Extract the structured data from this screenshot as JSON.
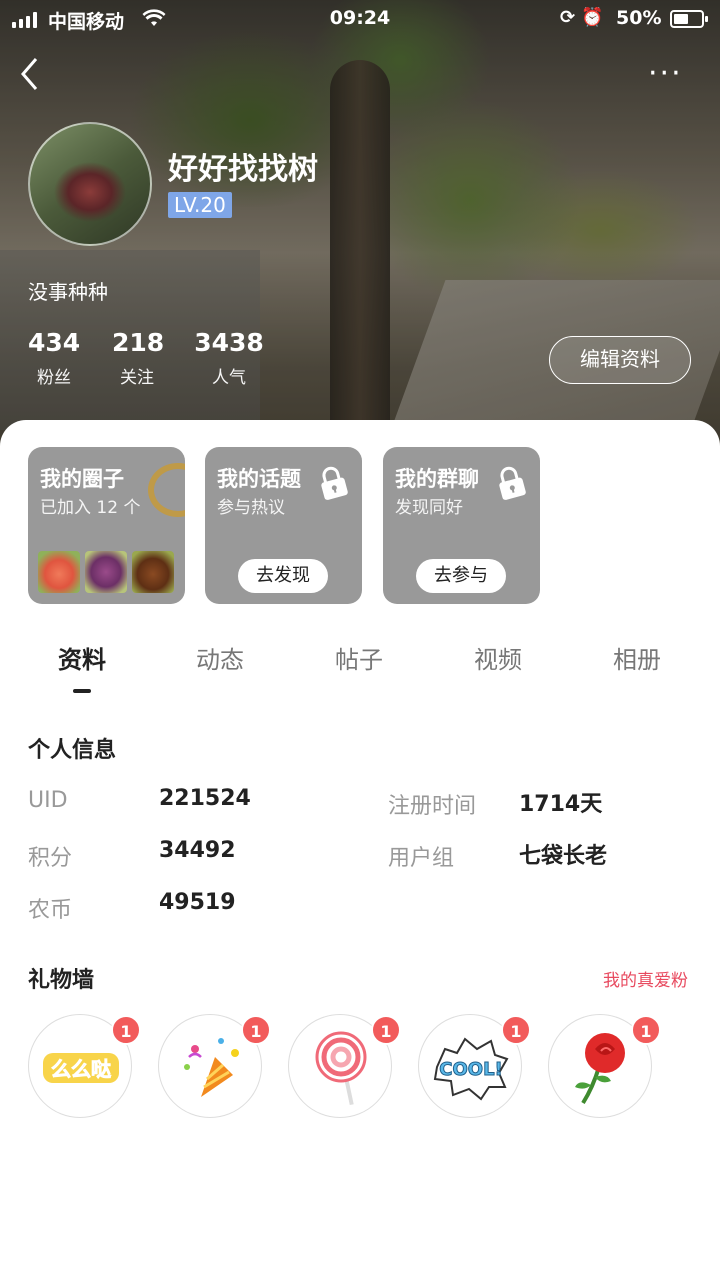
{
  "status_bar": {
    "carrier": "中国移动",
    "time": "09:24",
    "battery": "50%"
  },
  "profile": {
    "username": "好好找找树",
    "level": "LV.20",
    "bio": "没事种种",
    "stats": [
      {
        "value": "434",
        "label": "粉丝"
      },
      {
        "value": "218",
        "label": "关注"
      },
      {
        "value": "3438",
        "label": "人气"
      }
    ],
    "edit_button": "编辑资料"
  },
  "cards": [
    {
      "title": "我的圈子",
      "subtitle": "已加入 12 个"
    },
    {
      "title": "我的话题",
      "subtitle": "参与热议",
      "cta": "去发现"
    },
    {
      "title": "我的群聊",
      "subtitle": "发现同好",
      "cta": "去参与"
    }
  ],
  "tabs": [
    "资料",
    "动态",
    "帖子",
    "视频",
    "相册"
  ],
  "personal_info": {
    "title": "个人信息",
    "uid_label": "UID",
    "uid": "221524",
    "points_label": "积分",
    "points": "34492",
    "coins_label": "农币",
    "coins": "49519",
    "register_label": "注册时间",
    "register": "1714天",
    "group_label": "用户组",
    "group": "七袋长老"
  },
  "gift_wall": {
    "title": "礼物墙",
    "fans_link": "我的真爱粉",
    "gifts": [
      {
        "icon": "memeda-text-icon",
        "count": "1"
      },
      {
        "icon": "party-popper-icon",
        "count": "1"
      },
      {
        "icon": "lollipop-icon",
        "count": "1"
      },
      {
        "icon": "cool-sticker-icon",
        "count": "1"
      },
      {
        "icon": "rose-icon",
        "count": "1"
      }
    ]
  },
  "colors": {
    "level_badge": "#7fa6e8",
    "card_bg": "#999999",
    "fans_link": "#e84a5f",
    "badge": "#f25b5b"
  }
}
